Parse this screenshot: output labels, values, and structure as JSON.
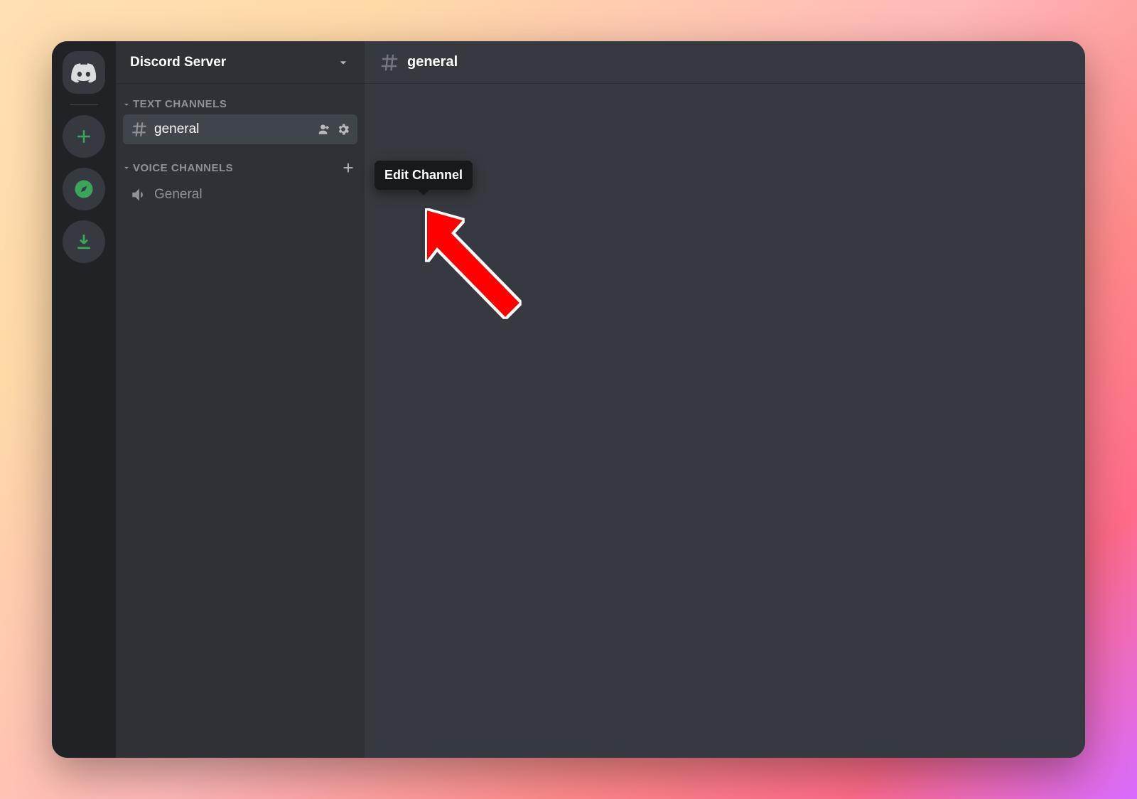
{
  "server": {
    "name": "Discord Server"
  },
  "header": {
    "channel_name": "general"
  },
  "sidebar": {
    "text_category": "TEXT CHANNELS",
    "voice_category": "VOICE CHANNELS",
    "text_channels": [
      {
        "name": "general",
        "active": true
      }
    ],
    "voice_channels": [
      {
        "name": "General"
      }
    ]
  },
  "tooltip": {
    "text": "Edit Channel"
  },
  "icons": {
    "home": "discord-logo-icon",
    "add_server": "plus-icon",
    "explore": "compass-icon",
    "download": "download-icon",
    "chevron_down": "chevron-down-icon",
    "hash": "hash-icon",
    "speaker": "speaker-icon",
    "invite": "invite-user-icon",
    "gear": "gear-icon",
    "plus_small": "plus-icon"
  },
  "colors": {
    "rail_bg": "#202225",
    "sidebar_bg": "#2f3136",
    "chat_bg": "#36393f",
    "active_bg": "#40444b",
    "tooltip_bg": "#18191c",
    "green_accent": "#3ba55c",
    "arrow_red": "#ff0000"
  }
}
